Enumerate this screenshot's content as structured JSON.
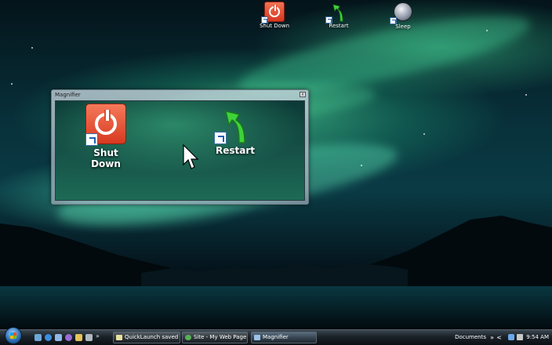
{
  "desktop_icons": [
    {
      "label": "Shut Down",
      "icon": "shut-down-icon"
    },
    {
      "label": "Restart",
      "icon": "restart-arrow-icon"
    },
    {
      "label": "Sleep",
      "icon": "sleep-moon-icon"
    }
  ],
  "magnifier": {
    "title": "Magnifier",
    "close_glyph": "x",
    "shown_icons": [
      {
        "label": "Shut Down",
        "icon": "shut-down-icon"
      },
      {
        "label": "Restart",
        "icon": "restart-arrow-icon"
      }
    ]
  },
  "taskbar": {
    "quick_launch_icons": [
      "show-desktop-icon",
      "internet-explorer-icon",
      "switch-windows-icon",
      "media-player-icon",
      "email-icon",
      "app-icon"
    ],
    "buttons": [
      {
        "label": "QuickLaunch saved",
        "icon": "notepad-icon",
        "active": false
      },
      {
        "label": "Site - My Web Page",
        "icon": "web-page-icon",
        "active": false
      },
      {
        "label": "Magnifier",
        "icon": "magnifier-icon",
        "active": true
      }
    ],
    "toolbar_label": "Documents",
    "toolbar_chevron": "»",
    "tray_arrow": "<",
    "clock": "9:54 AM"
  },
  "colors": {
    "aurora": "#4cf0a8",
    "power_red": "#d7361f",
    "restart_green": "#3fd23a",
    "taskbar": "#1a2228"
  }
}
